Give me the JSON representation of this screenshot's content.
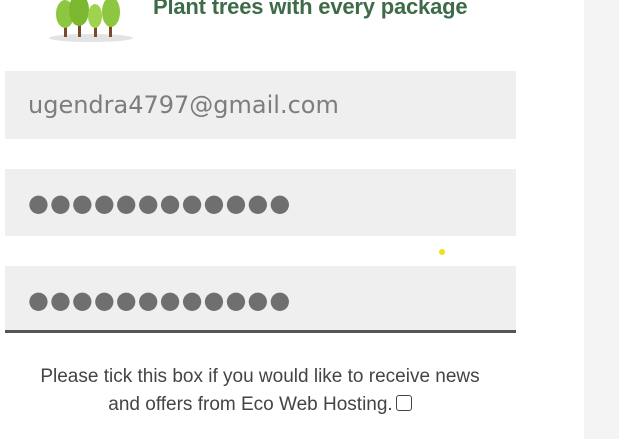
{
  "banner": {
    "text": "Plant trees with every package",
    "icon": "trees-icon"
  },
  "form": {
    "email_value": "ugendra4797@gmail.com",
    "password_mask": "●●●●●●●●●●●●",
    "confirm_password_mask": "●●●●●●●●●●●●"
  },
  "consent": {
    "text": "Please tick this box if you would like to receive news and offers from Eco Web Hosting.",
    "checked": false
  },
  "colors": {
    "brand_green": "#3e6b48",
    "field_bg": "#efefef",
    "tree_green": "#8dc63f",
    "trunk_brown": "#7a4b2a"
  }
}
